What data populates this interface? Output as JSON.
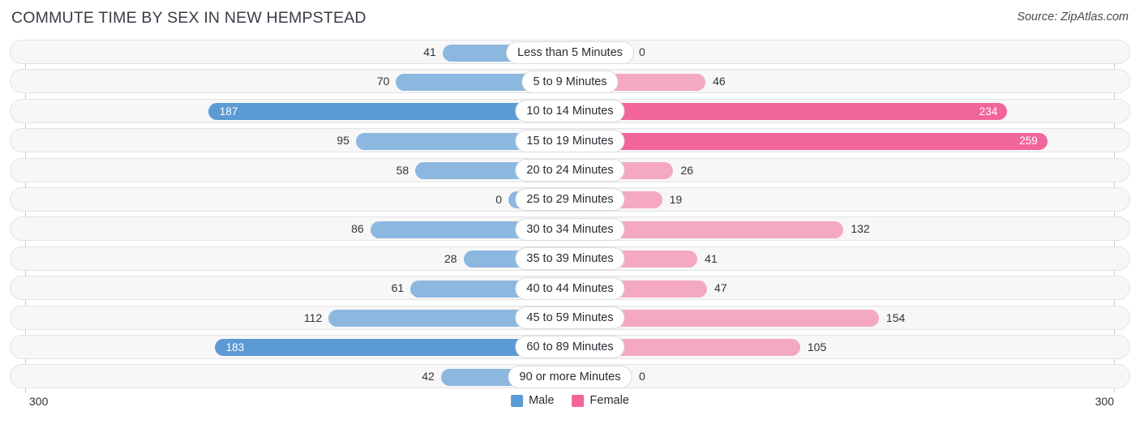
{
  "header": {
    "title": "COMMUTE TIME BY SEX IN NEW HEMPSTEAD",
    "source": "Source: ZipAtlas.com"
  },
  "axis": {
    "left_max_label": "300",
    "right_max_label": "300"
  },
  "legend": {
    "items": [
      {
        "label": "Male",
        "color": "#5b9bd5"
      },
      {
        "label": "Female",
        "color": "#f2659a"
      }
    ]
  },
  "colors": {
    "male_strong": "#5b9bd5",
    "male_light": "#8cb8e0",
    "female_strong": "#f2659a",
    "female_light": "#f4a8c4",
    "track_fill": "#f7f7f8",
    "track_border": "#e3e3e6",
    "axis_line": "#c9c9cf",
    "pill_bg": "#ffffff",
    "pill_border": "#dcdce0"
  },
  "chart_data": {
    "type": "bar",
    "subtype": "diverging-bidirectional-bar",
    "title": "COMMUTE TIME BY SEX IN NEW HEMPSTEAD",
    "xlabel": "",
    "ylabel": "",
    "xlim": [
      300,
      300
    ],
    "axis_max": 300,
    "grid": false,
    "legend_position": "bottom-center",
    "categories": [
      "Less than 5 Minutes",
      "5 to 9 Minutes",
      "10 to 14 Minutes",
      "15 to 19 Minutes",
      "20 to 24 Minutes",
      "25 to 29 Minutes",
      "30 to 34 Minutes",
      "35 to 39 Minutes",
      "40 to 44 Minutes",
      "45 to 59 Minutes",
      "60 to 89 Minutes",
      "90 or more Minutes"
    ],
    "series": [
      {
        "name": "Male",
        "direction": "left",
        "color": "#5b9bd5",
        "values": [
          41,
          70,
          187,
          95,
          58,
          0,
          86,
          28,
          61,
          112,
          183,
          42
        ]
      },
      {
        "name": "Female",
        "direction": "right",
        "color": "#f2659a",
        "values": [
          0,
          46,
          234,
          259,
          26,
          19,
          132,
          41,
          47,
          154,
          105,
          0
        ]
      }
    ]
  },
  "rows": [
    {
      "category": "Less than 5 Minutes",
      "male": 41,
      "male_label": "41",
      "female": 0,
      "female_label": "0"
    },
    {
      "category": "5 to 9 Minutes",
      "male": 70,
      "male_label": "70",
      "female": 46,
      "female_label": "46"
    },
    {
      "category": "10 to 14 Minutes",
      "male": 187,
      "male_label": "187",
      "female": 234,
      "female_label": "234"
    },
    {
      "category": "15 to 19 Minutes",
      "male": 95,
      "male_label": "95",
      "female": 259,
      "female_label": "259"
    },
    {
      "category": "20 to 24 Minutes",
      "male": 58,
      "male_label": "58",
      "female": 26,
      "female_label": "26"
    },
    {
      "category": "25 to 29 Minutes",
      "male": 0,
      "male_label": "0",
      "female": 19,
      "female_label": "19"
    },
    {
      "category": "30 to 34 Minutes",
      "male": 86,
      "male_label": "86",
      "female": 132,
      "female_label": "132"
    },
    {
      "category": "35 to 39 Minutes",
      "male": 28,
      "male_label": "28",
      "female": 41,
      "female_label": "41"
    },
    {
      "category": "40 to 44 Minutes",
      "male": 61,
      "male_label": "61",
      "female": 47,
      "female_label": "47"
    },
    {
      "category": "45 to 59 Minutes",
      "male": 112,
      "male_label": "112",
      "female": 154,
      "female_label": "154"
    },
    {
      "category": "60 to 89 Minutes",
      "male": 183,
      "male_label": "183",
      "female": 105,
      "female_label": "105"
    },
    {
      "category": "90 or more Minutes",
      "male": 42,
      "male_label": "42",
      "female": 0,
      "female_label": "0"
    }
  ]
}
